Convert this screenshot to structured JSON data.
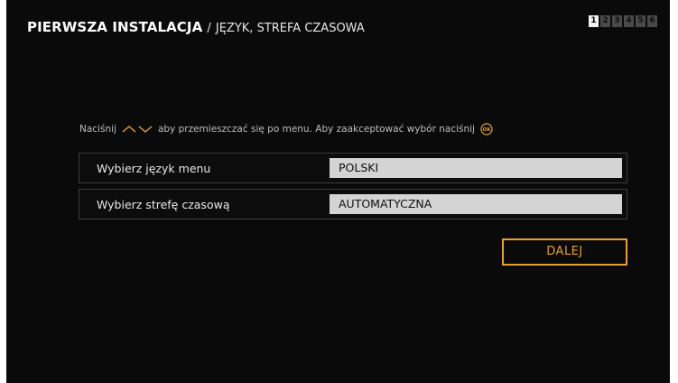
{
  "header": {
    "title": "PIERWSZA INSTALACJA",
    "separator": "/",
    "subtitle": "JĘZYK, STREFA CZASOWA"
  },
  "steps": {
    "items": [
      "1",
      "2",
      "3",
      "4",
      "5",
      "6"
    ],
    "current": 1
  },
  "hint": {
    "prefix": "Naciśnij",
    "middle": "aby przemieszczać się po menu. Aby zaakceptować wybór naciśnij",
    "arrows_icon": "up-down-arrows-icon",
    "ok_icon": "ok-button-icon",
    "ok_label": "OK"
  },
  "settings": [
    {
      "label": "Wybierz język menu",
      "value": "POLSKI"
    },
    {
      "label": "Wybierz strefę czasową",
      "value": "AUTOMATYCZNA"
    }
  ],
  "next_button": {
    "label": "DALEJ"
  },
  "colors": {
    "accent": "#e7a12b",
    "background": "#0a0a0a",
    "value_box": "#d4d4d4"
  }
}
